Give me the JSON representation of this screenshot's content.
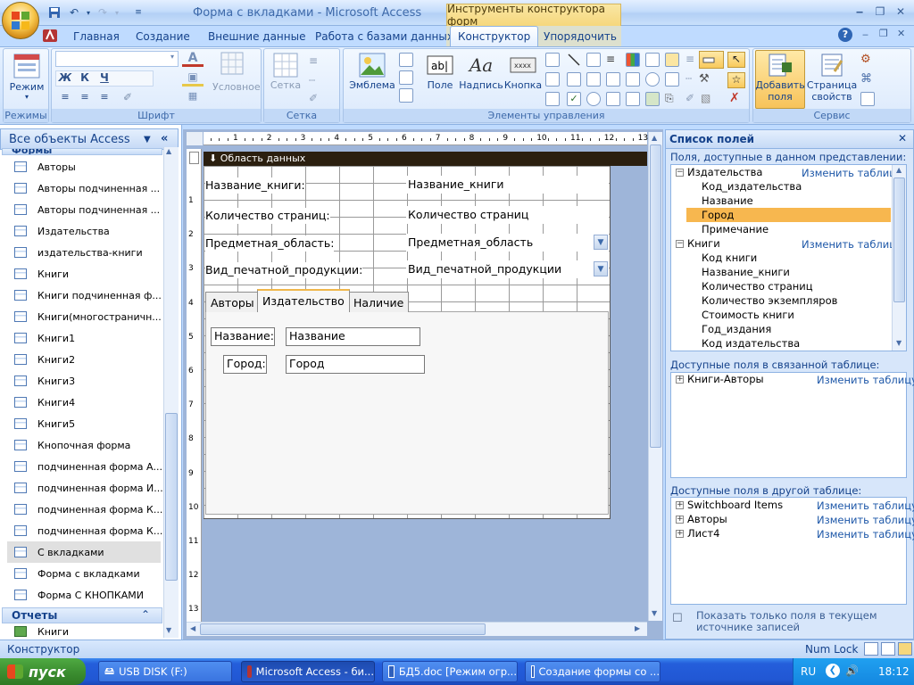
{
  "window": {
    "title": "Форма с вкладками - Microsoft Access",
    "contextual_title": "Инструменты конструктора форм"
  },
  "ribbon_tabs": [
    "Главная",
    "Создание",
    "Внешние данные",
    "Работа с базами данных",
    "Конструктор",
    "Упорядочить"
  ],
  "ribbon": {
    "groups": {
      "views": "Режимы",
      "font": "Шрифт",
      "grid": "Сетка",
      "controls": "Элементы управления",
      "tools": "Сервис"
    },
    "views_button": "Режим",
    "conditional": "Условное",
    "grid_button": "Сетка",
    "logo_button": "Эмблема",
    "field_button": "Поле",
    "label_button": "Надпись",
    "button_button": "Кнопка",
    "add_fields_button_line1": "Добавить",
    "add_fields_button_line2": "поля",
    "property_sheet_line1": "Страница",
    "property_sheet_line2": "свойств"
  },
  "nav": {
    "header": "Все объекты Access",
    "forms_group": "Формы",
    "reports_group": "Отчеты",
    "items": [
      "Авторы",
      "Авторы подчиненная ...",
      "Авторы подчиненная ...",
      "Издательства",
      "издательства-книги",
      "Книги",
      "Книги подчиненная ф...",
      "Книги(многостраничн...",
      "Книги1",
      "Книги2",
      "Книги3",
      "Книги4",
      "Книги5",
      "Кнопочная форма",
      "подчиненная форма А...",
      "подчиненная форма И...",
      "подчиненная форма К...",
      "подчиненная форма К...",
      "С вкладками",
      "Форма с вкладками",
      "Форма С КНОПКАМИ"
    ],
    "report_items": [
      "Книги"
    ]
  },
  "form": {
    "section": "Область данных",
    "ruler_top": [
      "1",
      "2",
      "3",
      "4",
      "5",
      "6",
      "7",
      "8",
      "9",
      "10",
      "11",
      "12",
      "13"
    ],
    "ruler_left": [
      "1",
      "2",
      "3",
      "4",
      "5",
      "6",
      "7",
      "8",
      "9",
      "10",
      "11",
      "12",
      "13"
    ],
    "rows": [
      {
        "label": "Название_книги:",
        "field": "Название_книги"
      },
      {
        "label": "Количество страниц:",
        "field": "Количество страниц"
      },
      {
        "label": "Предметная_область:",
        "field": "Предметная_область"
      },
      {
        "label": "Вид_печатной_продукции:",
        "field": "Вид_печатной_продукции"
      }
    ],
    "tabs": [
      "Авторы",
      "Издательство",
      "Наличие"
    ],
    "tab_fields": [
      {
        "label": "Название:",
        "field": "Название"
      },
      {
        "label": "Город:",
        "field": "Город"
      }
    ]
  },
  "field_list": {
    "title": "Список полей",
    "current_caption": "Поля, доступные в данном представлении:",
    "related_caption": "Доступные поля в связанной таблице:",
    "other_caption": "Доступные поля в другой таблице:",
    "edit_table": "Изменить таблицу",
    "tables": [
      {
        "name": "Издательства",
        "fields": [
          "Код_издательства",
          "Название",
          "Город",
          "Примечание"
        ]
      },
      {
        "name": "Книги",
        "fields": [
          "Код книги",
          "Название_книги",
          "Количество страниц",
          "Количество экземпляров",
          "Стоимость книги",
          "Год_издания",
          "Код издательства"
        ]
      }
    ],
    "selected_field": "Город",
    "related_tables": [
      "Книги-Авторы"
    ],
    "other_tables": [
      "Switchboard Items",
      "Авторы",
      "Лист4"
    ],
    "footer": "Показать только поля в текущем источнике записей"
  },
  "status": {
    "left": "Конструктор",
    "right": "Num Lock"
  },
  "taskbar": {
    "start": "пуск",
    "tasks": [
      "USB DISK (F:)",
      "Microsoft Access - би...",
      "БД5.doc [Режим огр...",
      "Создание формы со ..."
    ],
    "lang": "RU",
    "clock": "18:12"
  },
  "colors": {
    "accent": "#15428b",
    "ribbon_bg": "#d2e5fd",
    "section_bar": "#2b1f0f",
    "selected_field": "#f7b74f",
    "taskbar": "#245edb"
  }
}
